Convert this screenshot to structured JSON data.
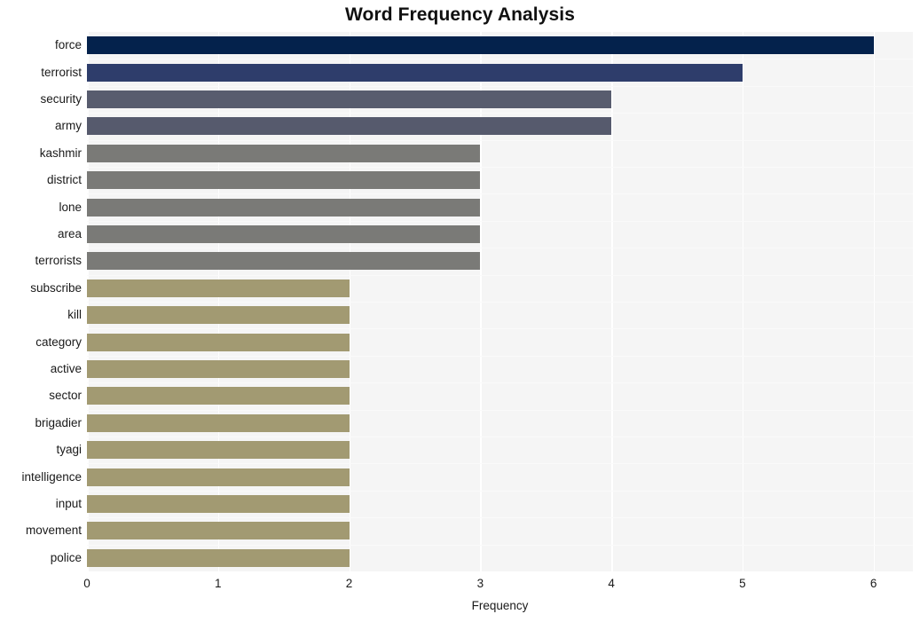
{
  "chart_data": {
    "type": "bar",
    "orientation": "horizontal",
    "title": "Word Frequency Analysis",
    "xlabel": "Frequency",
    "ylabel": "",
    "xlim": [
      0,
      6.3
    ],
    "xticks": [
      "0",
      "1",
      "2",
      "3",
      "4",
      "5",
      "6"
    ],
    "xtick_values": [
      0,
      1,
      2,
      3,
      4,
      5,
      6
    ],
    "grid": "vertical-white-on-lightgray",
    "legend": "none",
    "background": "#f5f5f5",
    "categories": [
      "force",
      "terrorist",
      "security",
      "army",
      "kashmir",
      "district",
      "lone",
      "area",
      "terrorists",
      "subscribe",
      "kill",
      "category",
      "active",
      "sector",
      "brigadier",
      "tyagi",
      "intelligence",
      "input",
      "movement",
      "police"
    ],
    "values": [
      6,
      5,
      4,
      4,
      3,
      3,
      3,
      3,
      3,
      2,
      2,
      2,
      2,
      2,
      2,
      2,
      2,
      2,
      2,
      2
    ],
    "bar_colors": [
      "#04224c",
      "#2e3d6b",
      "#585c6e",
      "#565a6d",
      "#7a7a77",
      "#7a7a77",
      "#7a7a77",
      "#7a7a77",
      "#7a7a77",
      "#a29a72",
      "#a29a72",
      "#a29a72",
      "#a29a72",
      "#a29a72",
      "#a29a72",
      "#a29a72",
      "#a29a72",
      "#a29a72",
      "#a29a72",
      "#a29a72"
    ]
  }
}
